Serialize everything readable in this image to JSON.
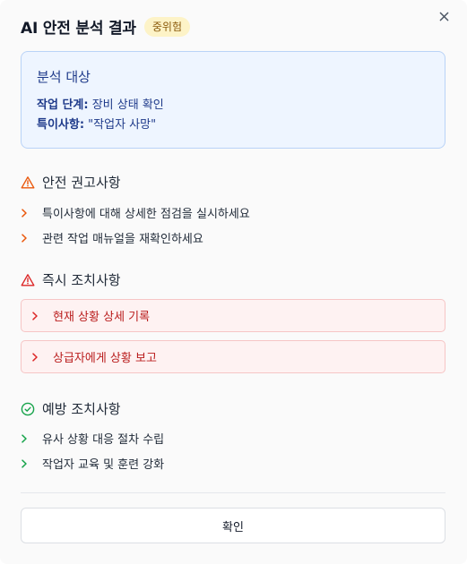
{
  "dialog": {
    "title": "AI 안전 분석 결과",
    "risk_badge": "중위험",
    "close_icon": "close-icon"
  },
  "analysis_target": {
    "heading": "분석 대상",
    "work_stage_label": "작업 단계:",
    "work_stage_value": " 장비 상태 확인",
    "special_note_label": "특이사항:",
    "special_note_value": " \"작업자 사망\""
  },
  "safety_recommendations": {
    "heading": "안전 권고사항",
    "icon": "warning-triangle-icon",
    "items": [
      "특이사항에 대해 상세한 점검을 실시하세요",
      "관련 작업 매뉴얼을 재확인하세요"
    ]
  },
  "immediate_actions": {
    "heading": "즉시 조치사항",
    "icon": "alert-triangle-icon",
    "items": [
      "현재 상황 상세 기록",
      "상급자에게 상황 보고"
    ]
  },
  "preventive_actions": {
    "heading": "예방 조치사항",
    "icon": "check-circle-icon",
    "items": [
      "유사 상황 대응 절차 수립",
      "작업자 교육 및 훈련 강화"
    ]
  },
  "footer": {
    "confirm_label": "확인"
  },
  "colors": {
    "orange": "#ea580c",
    "red": "#dc2626",
    "green": "#16a34a",
    "blue_text": "#1e3a8a",
    "badge_bg": "#fdf3c7"
  }
}
